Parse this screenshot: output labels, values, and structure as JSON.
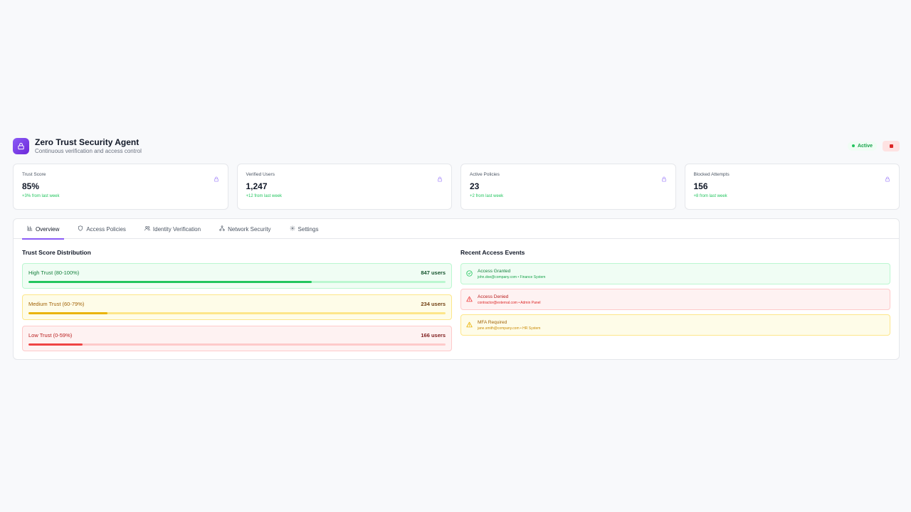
{
  "header": {
    "title": "Zero Trust Security Agent",
    "subtitle": "Continuous verification and access control",
    "status": "Active",
    "icon": "lock-icon"
  },
  "stats": [
    {
      "label": "Trust Score",
      "value": "85%",
      "change": "+3% from last week",
      "icon": "lock-icon"
    },
    {
      "label": "Verified Users",
      "value": "1,247",
      "change": "+12 from last week",
      "icon": "lock-icon"
    },
    {
      "label": "Active Policies",
      "value": "23",
      "change": "+2 from last week",
      "icon": "lock-icon"
    },
    {
      "label": "Blocked Attempts",
      "value": "156",
      "change": "+8 from last week",
      "icon": "lock-icon"
    }
  ],
  "tabs": [
    {
      "label": "Overview",
      "icon": "bar-chart-icon",
      "active": true
    },
    {
      "label": "Access Policies",
      "icon": "shield-icon",
      "active": false
    },
    {
      "label": "Identity Verification",
      "icon": "users-icon",
      "active": false
    },
    {
      "label": "Network Security",
      "icon": "network-icon",
      "active": false
    },
    {
      "label": "Settings",
      "icon": "gear-icon",
      "active": false
    }
  ],
  "distribution": {
    "title": "Trust Score Distribution",
    "rows": [
      {
        "label": "High Trust (80-100%)",
        "count": "847 users",
        "fraction": 0.68
      },
      {
        "label": "Medium Trust (60-79%)",
        "count": "234 users",
        "fraction": 0.19
      },
      {
        "label": "Low Trust (0-59%)",
        "count": "166 users",
        "fraction": 0.13
      }
    ]
  },
  "events": {
    "title": "Recent Access Events",
    "items": [
      {
        "title": "Access Granted",
        "detail": "john.doe@company.com • Finance System",
        "icon": "check-circle-icon"
      },
      {
        "title": "Access Denied",
        "detail": "contractor@external.com • Admin Panel",
        "icon": "alert-triangle-icon"
      },
      {
        "title": "MFA Required",
        "detail": "jane.smith@company.com • HR System",
        "icon": "alert-triangle-icon"
      }
    ]
  },
  "colors": {
    "accent": "#8b5cf6",
    "success": "#22c55e",
    "warning": "#eab308",
    "danger": "#ef4444"
  }
}
